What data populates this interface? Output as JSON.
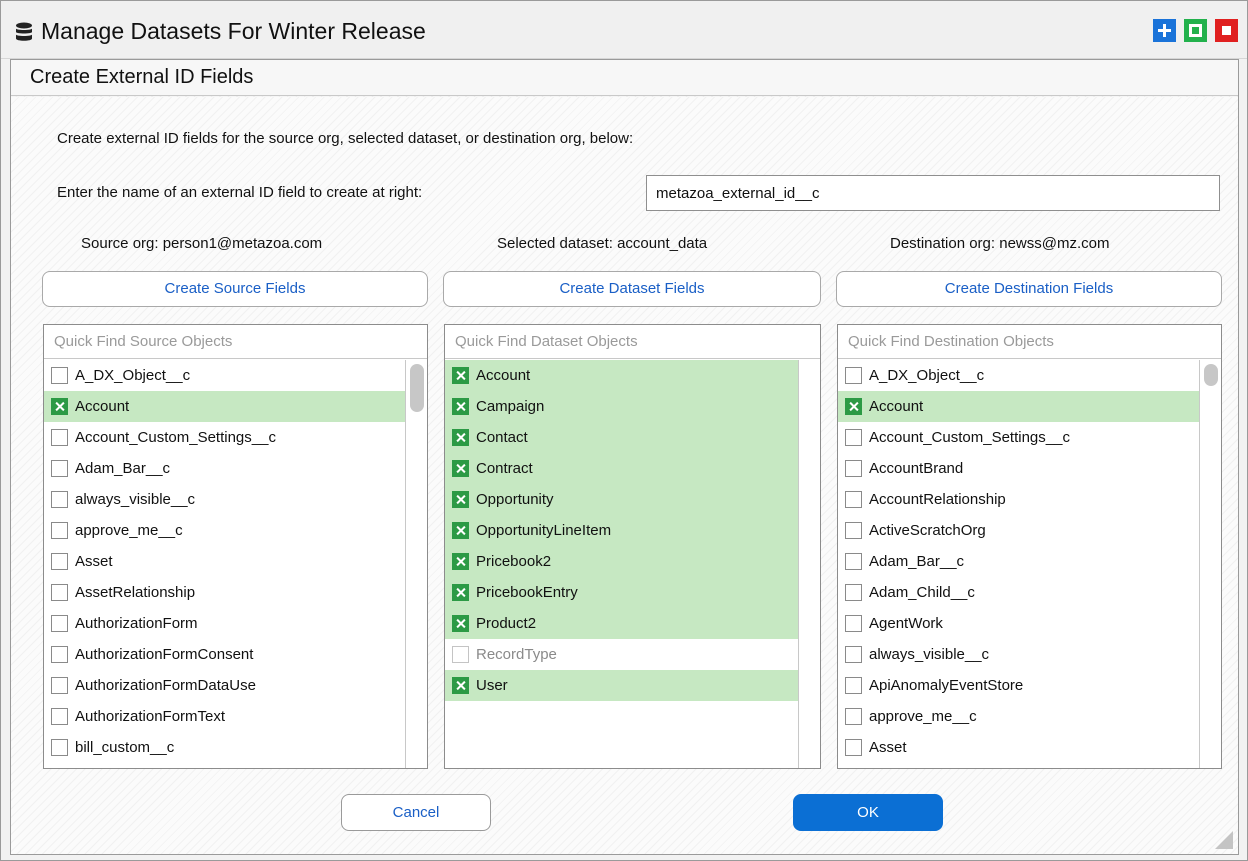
{
  "window": {
    "title": "Manage Datasets For Winter Release",
    "title_icon": "database-icon",
    "buttons": [
      {
        "icon": "plus-icon",
        "color": "#1a73d9"
      },
      {
        "icon": "maximize-icon",
        "color": "#22b14c"
      },
      {
        "icon": "close-icon",
        "color": "#e02020"
      }
    ]
  },
  "dialog": {
    "title": "Create External ID Fields",
    "intro": "Create external ID fields for the source org, selected dataset, or destination org, below:",
    "name_label": "Enter the name of an external ID field to create at right:",
    "name_value": "metazoa_external_id__c",
    "source": {
      "org_label": "Source org: person1@metazoa.com",
      "button": "Create Source Fields",
      "search_placeholder": "Quick Find Source Objects",
      "items": [
        {
          "label": "A_DX_Object__c",
          "checked": false
        },
        {
          "label": "Account",
          "checked": true
        },
        {
          "label": "Account_Custom_Settings__c",
          "checked": false
        },
        {
          "label": "Adam_Bar__c",
          "checked": false
        },
        {
          "label": "always_visible__c",
          "checked": false
        },
        {
          "label": "approve_me__c",
          "checked": false
        },
        {
          "label": "Asset",
          "checked": false
        },
        {
          "label": "AssetRelationship",
          "checked": false
        },
        {
          "label": "AuthorizationForm",
          "checked": false
        },
        {
          "label": "AuthorizationFormConsent",
          "checked": false
        },
        {
          "label": "AuthorizationFormDataUse",
          "checked": false
        },
        {
          "label": "AuthorizationFormText",
          "checked": false
        },
        {
          "label": "bill_custom__c",
          "checked": false
        }
      ]
    },
    "dataset": {
      "org_label": "Selected dataset: account_data",
      "button": "Create Dataset Fields",
      "search_placeholder": "Quick Find Dataset Objects",
      "items": [
        {
          "label": "Account",
          "checked": true
        },
        {
          "label": "Campaign",
          "checked": true
        },
        {
          "label": "Contact",
          "checked": true
        },
        {
          "label": "Contract",
          "checked": true
        },
        {
          "label": "Opportunity",
          "checked": true
        },
        {
          "label": "OpportunityLineItem",
          "checked": true
        },
        {
          "label": "Pricebook2",
          "checked": true
        },
        {
          "label": "PricebookEntry",
          "checked": true
        },
        {
          "label": "Product2",
          "checked": true
        },
        {
          "label": "RecordType",
          "checked": false,
          "disabled": true
        },
        {
          "label": "User",
          "checked": true
        }
      ]
    },
    "destination": {
      "org_label": "Destination org: newss@mz.com",
      "button": "Create Destination Fields",
      "search_placeholder": "Quick Find Destination Objects",
      "items": [
        {
          "label": "A_DX_Object__c",
          "checked": false
        },
        {
          "label": "Account",
          "checked": true
        },
        {
          "label": "Account_Custom_Settings__c",
          "checked": false
        },
        {
          "label": "AccountBrand",
          "checked": false
        },
        {
          "label": "AccountRelationship",
          "checked": false
        },
        {
          "label": "ActiveScratchOrg",
          "checked": false
        },
        {
          "label": "Adam_Bar__c",
          "checked": false
        },
        {
          "label": "Adam_Child__c",
          "checked": false
        },
        {
          "label": "AgentWork",
          "checked": false
        },
        {
          "label": "always_visible__c",
          "checked": false
        },
        {
          "label": "ApiAnomalyEventStore",
          "checked": false
        },
        {
          "label": "approve_me__c",
          "checked": false
        },
        {
          "label": "Asset",
          "checked": false
        }
      ]
    },
    "cancel_label": "Cancel",
    "ok_label": "OK"
  },
  "colors": {
    "selected_row": "#c6e8c2",
    "checkbox_checked": "#2c9a45",
    "link_blue": "#1a5fc6",
    "ok_button": "#0b6fd4"
  }
}
